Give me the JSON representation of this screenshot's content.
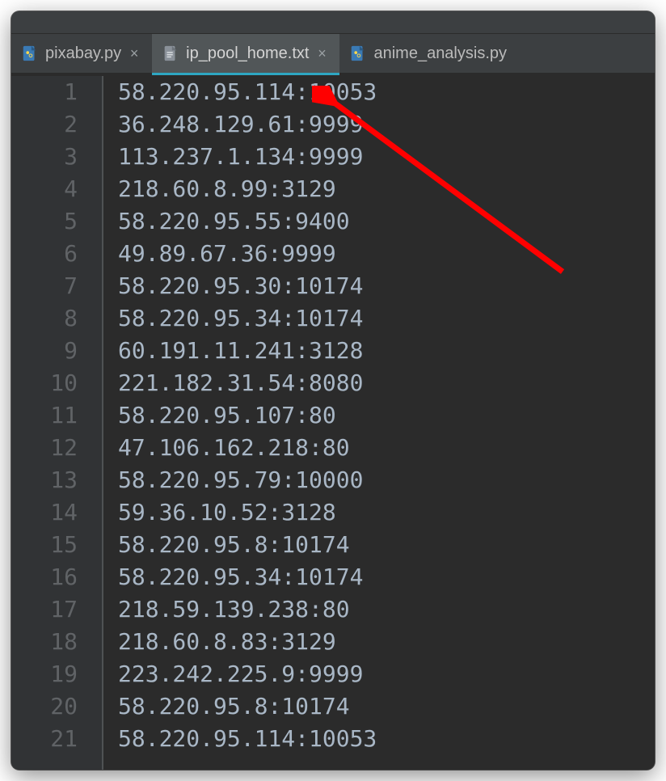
{
  "tabs": [
    {
      "label": "pixabay.py",
      "type": "python",
      "active": false,
      "closeable": true
    },
    {
      "label": "ip_pool_home.txt",
      "type": "text",
      "active": true,
      "closeable": true
    },
    {
      "label": "anime_analysis.py",
      "type": "python",
      "active": false,
      "closeable": false
    }
  ],
  "lines": [
    "58.220.95.114:10053",
    "36.248.129.61:9999",
    "113.237.1.134:9999",
    "218.60.8.99:3129",
    "58.220.95.55:9400",
    "49.89.67.36:9999",
    "58.220.95.30:10174",
    "58.220.95.34:10174",
    "60.191.11.241:3128",
    "221.182.31.54:8080",
    "58.220.95.107:80",
    "47.106.162.218:80",
    "58.220.95.79:10000",
    "59.36.10.52:3128",
    "58.220.95.8:10174",
    "58.220.95.34:10174",
    "218.59.139.238:80",
    "218.60.8.83:3129",
    "223.242.225.9:9999",
    "58.220.95.8:10174",
    "58.220.95.114:10053"
  ],
  "annotation": {
    "color": "#ff0000"
  }
}
